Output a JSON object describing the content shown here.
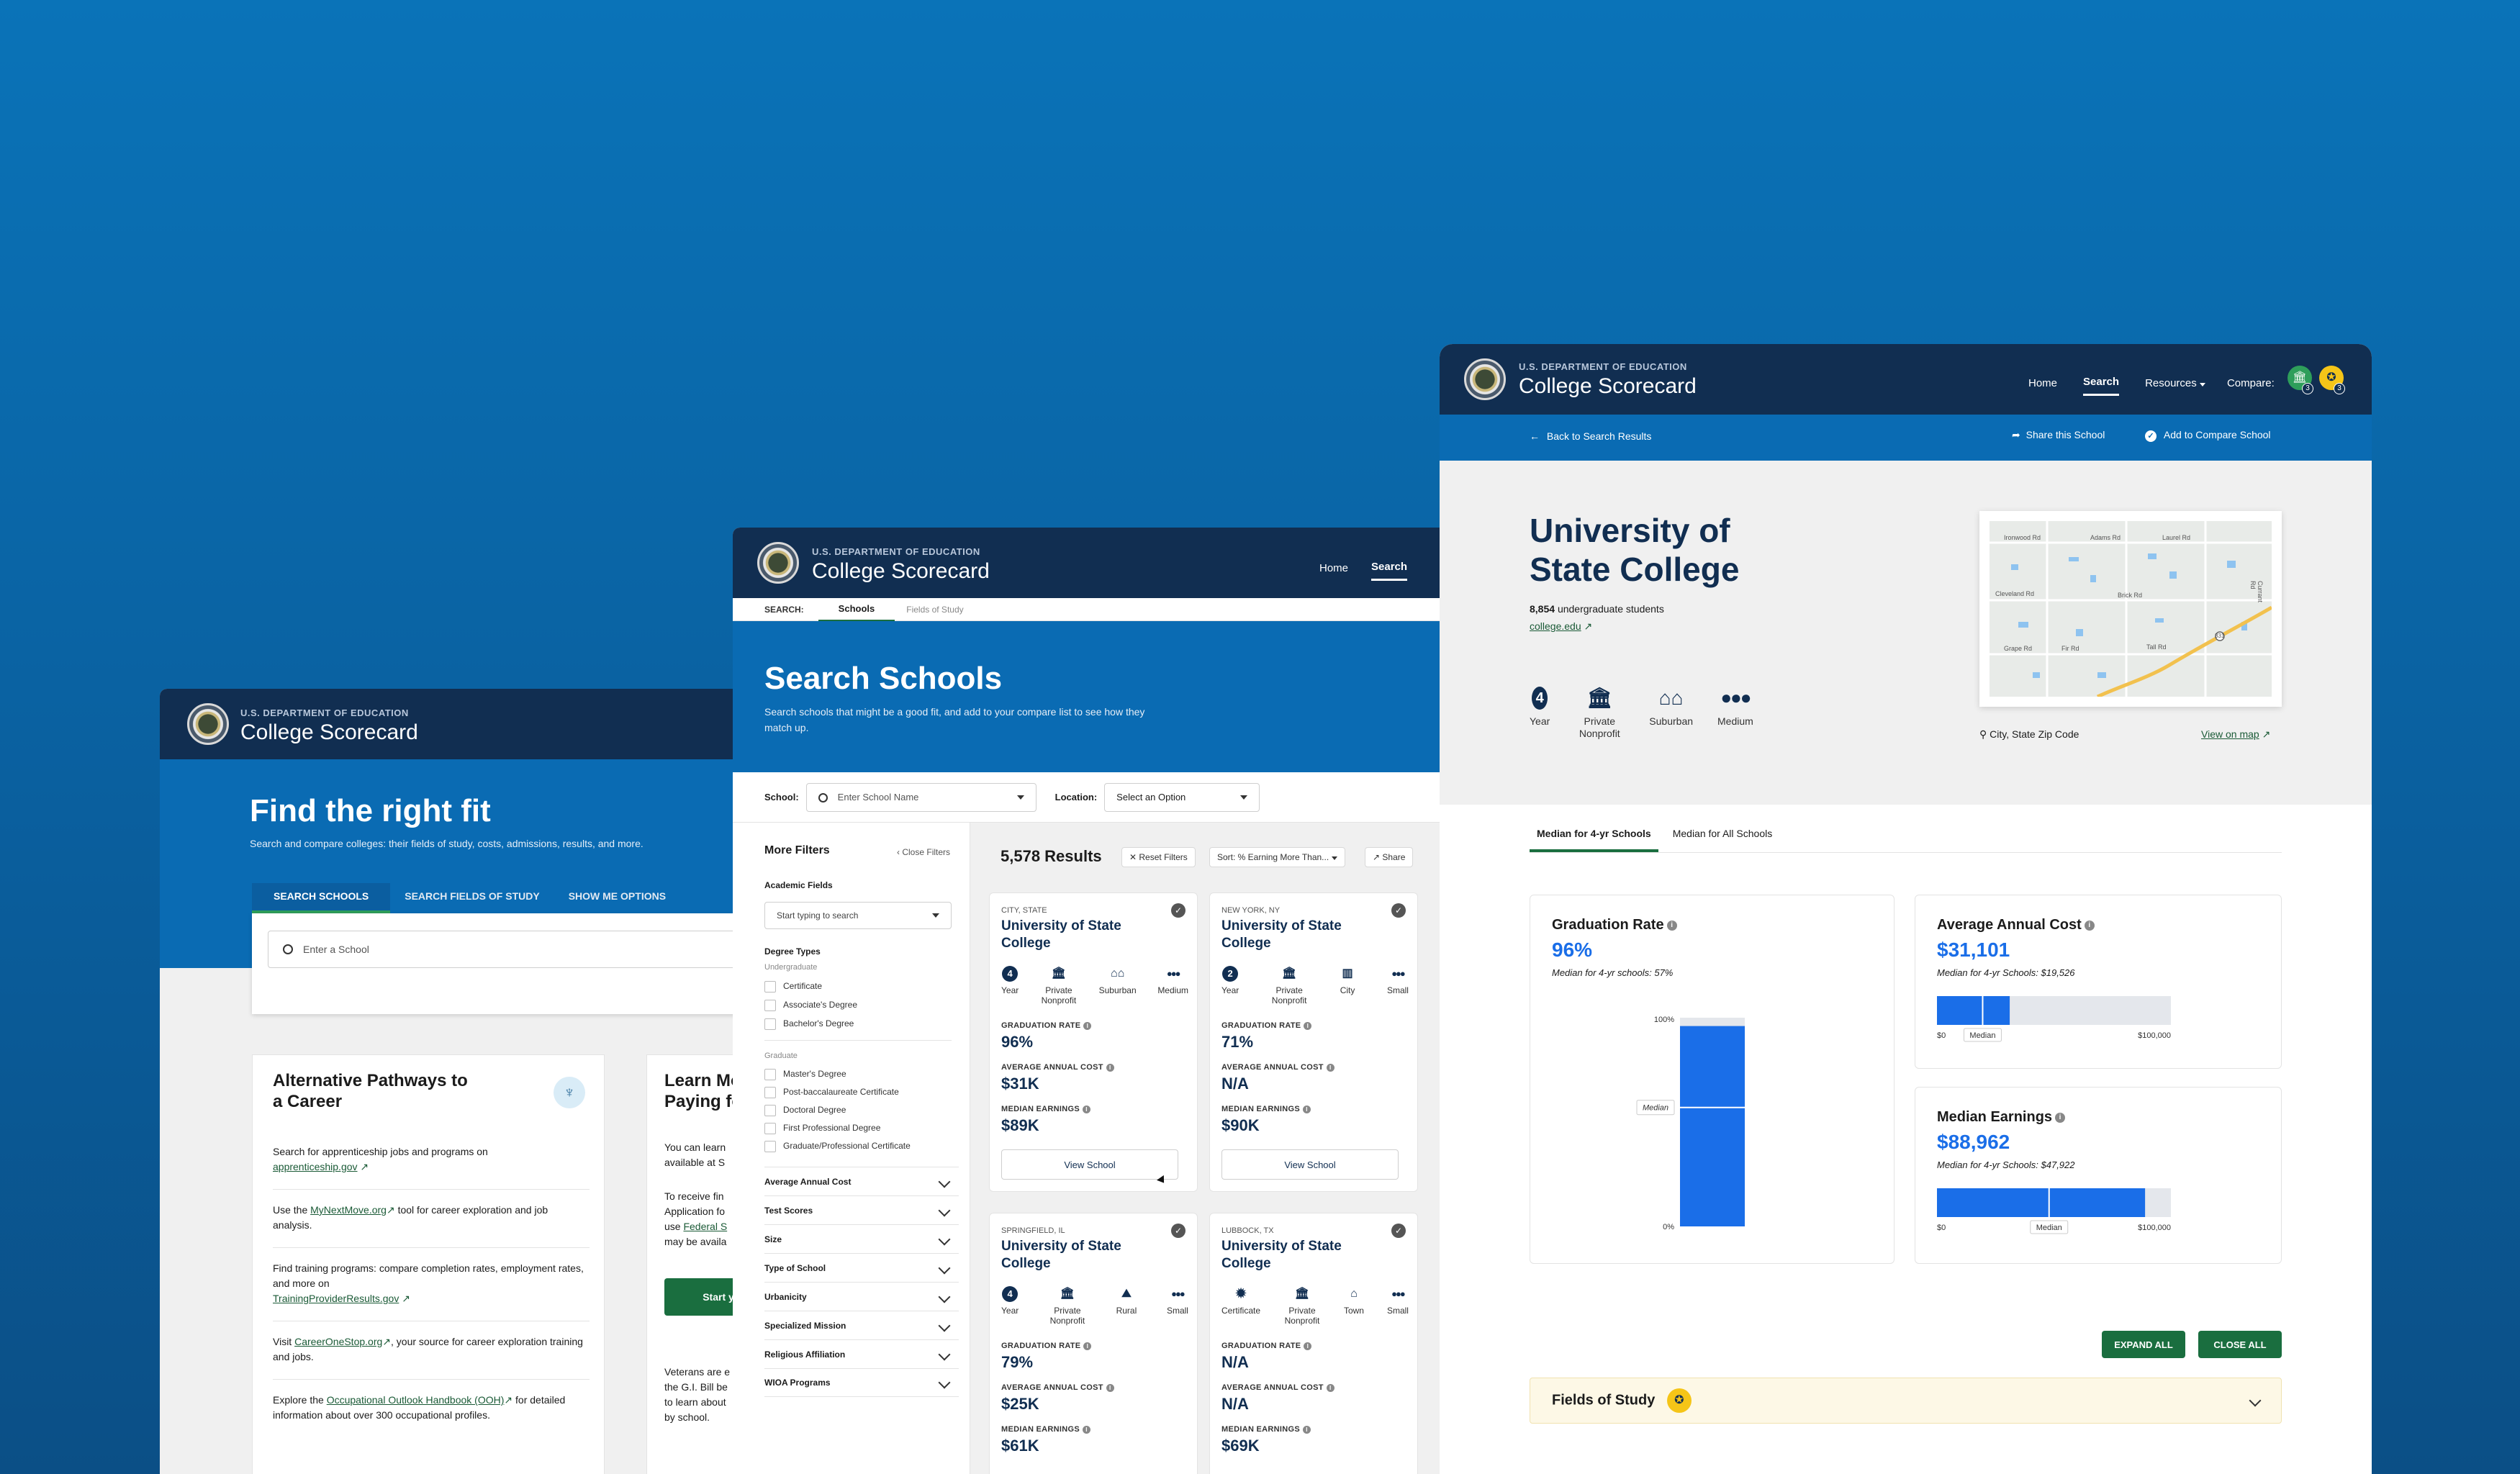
{
  "brand": {
    "dept": "U.S. DEPARTMENT OF EDUCATION",
    "name": "College Scorecard"
  },
  "home": {
    "title": "Find the right fit",
    "subtitle": "Search and compare colleges: their fields of study, costs, admissions, results, and more.",
    "tabs": [
      "SEARCH SCHOOLS",
      "SEARCH FIELDS OF STUDY",
      "SHOW ME OPTIONS"
    ],
    "search_placeholder": "Enter a School",
    "alt_card": {
      "title": "Alternative Pathways to a Career",
      "items": [
        {
          "pre": "Search for apprenticeship jobs and programs on",
          "link": "apprenticeship.gov",
          "post": ""
        },
        {
          "pre": "Use the",
          "link": "MyNextMove.org",
          "post": "tool for career exploration and job analysis."
        },
        {
          "pre": "Find training programs: compare completion rates, employment rates, and more on",
          "link": "TrainingProviderResults.gov",
          "post": ""
        },
        {
          "pre": "Visit",
          "link": "CareerOneStop.org",
          "post": ", your source for career exploration training and jobs."
        },
        {
          "pre": "Explore the",
          "link": "Occupational Outlook Handbook (OOH)",
          "post": "for detailed information about over 300 occupational profiles."
        }
      ]
    },
    "learn_card": {
      "title": "Learn Mo",
      "title2": "Paying fo",
      "p1a": "You can learn",
      "p1b": "available at S",
      "p2a": "To receive fin",
      "p2b": "Application fo",
      "p2c": "use",
      "p2c_link": "Federal S",
      "p2d": "may be availa",
      "button": "Start y",
      "p3a": "Veterans are e",
      "p3b": "the G.I. Bill be",
      "p3c": "to learn about",
      "p3d": "by school."
    }
  },
  "search": {
    "nav": [
      "Home",
      "Search"
    ],
    "subnav_label": "SEARCH:",
    "subnav_tabs": [
      "Schools",
      "Fields of Study"
    ],
    "title": "Search Schools",
    "subtitle": "Search schools that might be a good fit, and add to your compare list to see how they match up.",
    "school_label": "School:",
    "school_placeholder": "Enter School Name",
    "location_label": "Location:",
    "location_value": "Select an Option",
    "filters_title": "More Filters",
    "close_filters": "Close Filters",
    "academic_fields": "Academic Fields",
    "academic_placeholder": "Start typing to search",
    "degree_types": "Degree Types",
    "undergrad_label": "Undergraduate",
    "undergrad": [
      "Certificate",
      "Associate's Degree",
      "Bachelor's Degree"
    ],
    "grad_label": "Graduate",
    "grad": [
      "Master's Degree",
      "Post-baccalaureate Certificate",
      "Doctoral Degree",
      "First Professional Degree",
      "Graduate/Professional Certificate"
    ],
    "accordions": [
      "Average Annual Cost",
      "Test Scores",
      "Size",
      "Type of School",
      "Urbanicity",
      "Specialized Mission",
      "Religious Affiliation",
      "WIOA Programs"
    ],
    "results_count": "5,578 Results",
    "reset": "Reset Filters",
    "sort": "Sort: % Earning More Than...",
    "share": "Share",
    "metric_labels": [
      "GRADUATION RATE",
      "AVERAGE ANNUAL COST",
      "MEDIAN EARNINGS"
    ],
    "view_button": "View School",
    "cards": [
      {
        "loc": "CITY, STATE",
        "name": "University of State College",
        "years": "4",
        "type": "Private Nonprofit",
        "locale": "Suburban",
        "size": "Medium",
        "grad": "96%",
        "cost": "$31K",
        "earn": "$89K",
        "button": true
      },
      {
        "loc": "NEW YORK, NY",
        "name": "University of State College",
        "years": "2",
        "type": "Private Nonprofit",
        "locale": "City",
        "size": "Small",
        "grad": "71%",
        "cost": "N/A",
        "earn": "$90K",
        "button": true
      },
      {
        "loc": "SPRINGFIELD, IL",
        "name": "University of State College",
        "years": "4",
        "type": "Private Nonprofit",
        "locale": "Rural",
        "size": "Small",
        "grad": "79%",
        "cost": "$25K",
        "earn": "$61K",
        "button": false
      },
      {
        "loc": "LUBBOCK, TX",
        "name": "University of State College",
        "years": "Certificate",
        "type": "Private Nonprofit",
        "locale": "Town",
        "size": "Small",
        "grad": "N/A",
        "cost": "N/A",
        "earn": "$69K",
        "button": false
      }
    ],
    "year_label": "Year"
  },
  "detail": {
    "nav": [
      "Home",
      "Search",
      "Resources"
    ],
    "compare_label": "Compare:",
    "compare_counts": [
      "3",
      "3"
    ],
    "back": "Back to Search Results",
    "share": "Share this School",
    "add_compare": "Add to Compare School",
    "name": "University of State College",
    "students_num": "8,854",
    "students_text": "undergraduate students",
    "url": "college.edu",
    "icons": [
      {
        "glyph": "4",
        "label": "Year"
      },
      {
        "glyph": "bank",
        "label": "Private Nonprofit"
      },
      {
        "glyph": "houses",
        "label": "Suburban"
      },
      {
        "glyph": "people",
        "label": "Medium"
      }
    ],
    "map_streets": [
      "Adams Rd",
      "Brick Rd",
      "Cleveland Rd",
      "Currant Rd",
      "Ironwood Rd",
      "Laurel Rd",
      "Grape Rd",
      "Fir Rd",
      "Tall Rd",
      "331"
    ],
    "location": "City, State Zip Code",
    "view_map": "View on map",
    "tabs": [
      "Median for 4-yr Schools",
      "Median for All Schools"
    ],
    "grad": {
      "title": "Graduation Rate",
      "value": "96%",
      "median": "Median for 4-yr schools: 57%",
      "tick_top": "100%",
      "tick_bottom": "0%",
      "median_label": "Median"
    },
    "cost": {
      "title": "Average Annual Cost",
      "value": "$31,101",
      "median": "Median for 4-yr Schools: $19,526",
      "min": "$0",
      "max": "$100,000",
      "median_label": "Median"
    },
    "earn": {
      "title": "Median Earnings",
      "value": "$88,962",
      "median": "Median for 4-yr Schools: $47,922",
      "min": "$0",
      "max": "$100,000",
      "median_label": "Median"
    },
    "expand": "EXPAND ALL",
    "close": "CLOSE ALL",
    "fields": "Fields of Study"
  },
  "colors": {
    "navy": "#112e51",
    "blue": "#0a6bb3",
    "green": "#1a6e3f",
    "bar": "#1a6ee8",
    "gold": "#f5c518"
  },
  "chart_data": [
    {
      "type": "bar",
      "title": "Graduation Rate",
      "categories": [
        "This school"
      ],
      "values": [
        96
      ],
      "median": 57,
      "ylim": [
        0,
        100
      ],
      "xlabel": "",
      "ylabel": ""
    },
    {
      "type": "bar",
      "title": "Average Annual Cost",
      "categories": [
        "This school"
      ],
      "values": [
        31101
      ],
      "median": 19526,
      "xlim": [
        0,
        100000
      ],
      "xlabel": "",
      "ylabel": ""
    },
    {
      "type": "bar",
      "title": "Median Earnings",
      "categories": [
        "This school"
      ],
      "values": [
        88962
      ],
      "median": 47922,
      "xlim": [
        0,
        100000
      ],
      "xlabel": "",
      "ylabel": ""
    }
  ]
}
